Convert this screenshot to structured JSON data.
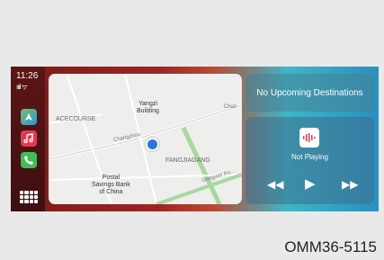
{
  "status": {
    "time": "11:26",
    "signal": "ıııl ᯤ"
  },
  "apps": {
    "maps_icon": "maps-icon",
    "music_icon": "music-icon",
    "phone_icon": "phone-icon",
    "grid_icon": "app-grid-icon"
  },
  "map": {
    "labels": {
      "yangzi": "Yangzi\nBuilding",
      "acecourse": "ACECOURSE",
      "fangjiagang": "FANGJIAGANG",
      "changzhou": "Changzhou",
      "postal": "Postal\nSavings Bank\nof China",
      "chan": "Chan",
      "gangwei": "Gangwei Ro...",
      "road_left": "Yangzi"
    }
  },
  "destinations": {
    "text": "No Upcoming Destinations"
  },
  "player": {
    "status": "Not Playing",
    "icon": "podcast-waveform-icon"
  },
  "caption": "OMM36-5115",
  "colors": {
    "accent_blue": "#2b76d6",
    "music_red": "#e63950"
  }
}
